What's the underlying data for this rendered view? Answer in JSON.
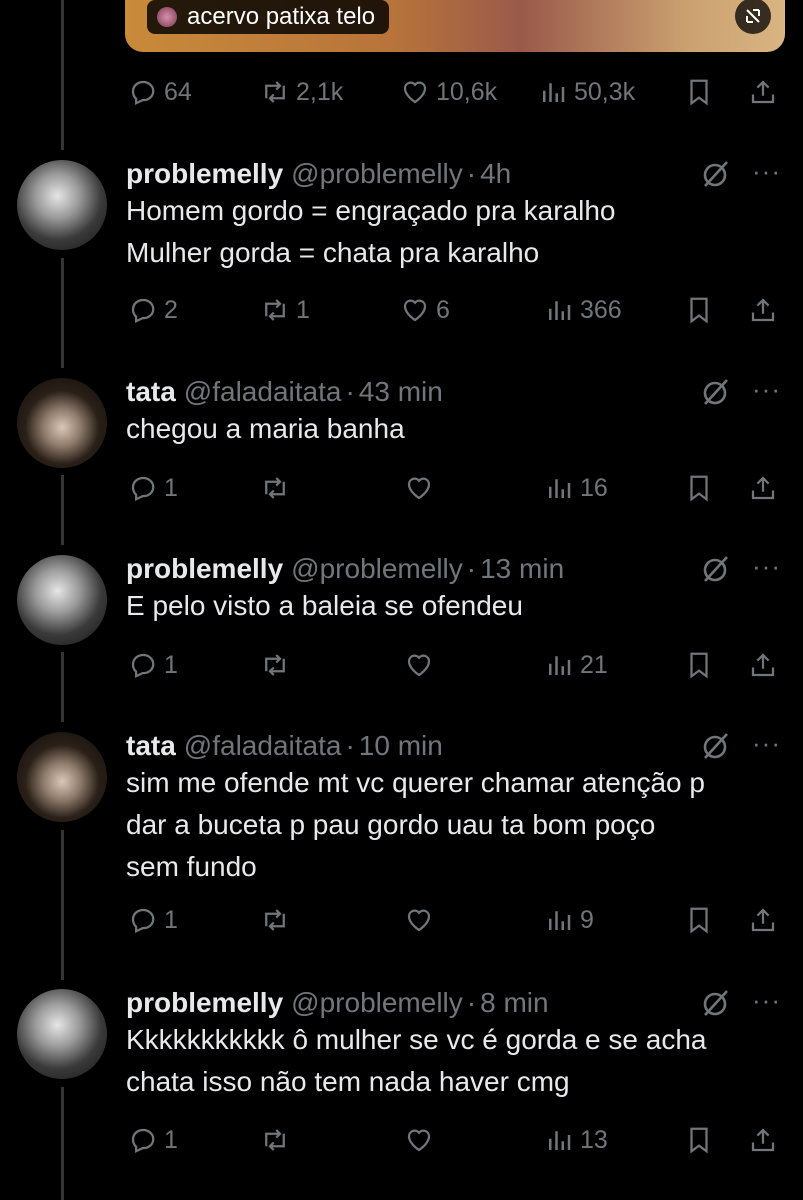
{
  "media": {
    "tag_label": "acervo patixa telo"
  },
  "top_actions": {
    "replies": "64",
    "reposts": "2,1k",
    "likes": "10,6k",
    "views": "50,3k"
  },
  "tweets": [
    {
      "name": "problemelly",
      "handle": "@problemelly",
      "sep": "·",
      "time": "4h",
      "text": "Homem gordo = engraçado pra karalho\nMulher gorda = chata pra karalho",
      "replies": "2",
      "reposts": "1",
      "likes": "6",
      "views": "366"
    },
    {
      "name": "tata",
      "handle": "@faladaitata",
      "sep": "·",
      "time": "43 min",
      "text": "chegou a maria banha",
      "replies": "1",
      "reposts": "",
      "likes": "",
      "views": "16"
    },
    {
      "name": "problemelly",
      "handle": "@problemelly",
      "sep": "·",
      "time": "13 min",
      "text": "E pelo visto a baleia se ofendeu",
      "replies": "1",
      "reposts": "",
      "likes": "",
      "views": "21"
    },
    {
      "name": "tata",
      "handle": "@faladaitata",
      "sep": "·",
      "time": "10 min",
      "text": "sim me ofende mt vc querer chamar atenção p\ndar a buceta p pau gordo uau ta bom poço\nsem fundo",
      "replies": "1",
      "reposts": "",
      "likes": "",
      "views": "9"
    },
    {
      "name": "problemelly",
      "handle": "@problemelly",
      "sep": "·",
      "time": "8 min",
      "text": "Kkkkkkkkkkk ô mulher se vc é gorda e se acha\nchata isso não tem nada haver cmg",
      "replies": "1",
      "reposts": "",
      "likes": "",
      "views": "13"
    }
  ],
  "more_label": "···",
  "icons": [
    "reply-icon",
    "repost-icon",
    "like-icon",
    "views-icon",
    "bookmark-icon",
    "share-icon",
    "grok-icon",
    "more-icon"
  ],
  "colors": {
    "background": "#000000",
    "text": "#e7e9ea",
    "muted": "#71767b",
    "thread_line": "#333639"
  }
}
